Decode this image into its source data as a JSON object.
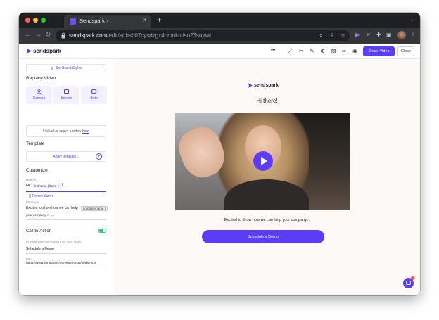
{
  "browser": {
    "tab_title": "Sendspark",
    "tab_suffix": "›",
    "url_host": "sendspark.com",
    "url_path": "/edit/adhsb07cysdzgx4bmokutiso23sujoal"
  },
  "header": {
    "logo_text": "sendspark",
    "more_label": "•••",
    "share_label": "Share Video",
    "close_label": "Close"
  },
  "sidebar": {
    "brand_styles_label": "Set Brand Styles",
    "replace_video_title": "Replace Video",
    "sources": [
      {
        "label": "Camera"
      },
      {
        "label": "Screen"
      },
      {
        "label": "Both"
      }
    ],
    "upload_text": "Upload or select a video",
    "upload_link": "here",
    "template_title": "Template",
    "apply_template_label": "Apply template...",
    "customize_title": "Customize",
    "header_label": "Header",
    "header_value_prefix": "Hi",
    "header_chip": "firstname | there",
    "personalize_label": "Personalize",
    "message_label": "Message",
    "message_value": "Excited to show how we can help",
    "message_chip1": "companyname |",
    "message_line2": "your company",
    "message_ellipsis": "...",
    "cta_title": "Call-to-Action",
    "cta_hint": "Provide your users with their next steps",
    "cta_value": "Schedule a Demo",
    "url_label": "URL",
    "url_value": "https://www.sendspark.com/meetings/bethany2t"
  },
  "preview": {
    "logo_text": "sendspark",
    "greeting": "Hi there!",
    "message": "Excited to show how we can help your company...",
    "cta_label": "Schedule a Demo"
  },
  "colors": {
    "accent": "#5b3df5",
    "toggle_on": "#31c58b"
  }
}
